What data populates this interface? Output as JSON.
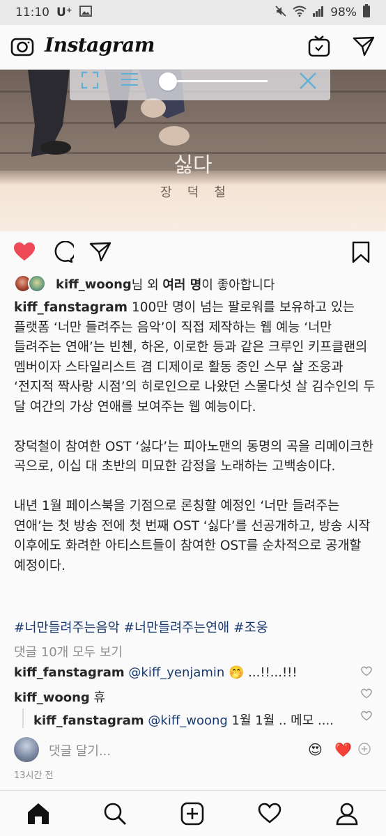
{
  "status_bar": {
    "time": "11:10",
    "carrier": "U⁺",
    "battery": "98%"
  },
  "header": {
    "logo": "Instagram"
  },
  "media": {
    "title": "싫다",
    "artist": "장덕철"
  },
  "likes": {
    "user": "kiff_woong",
    "middle": "님 외 ",
    "others": "여러 명",
    "suffix": "이 좋아합니다"
  },
  "caption": {
    "user": "kiff_fanstagram",
    "paragraphs": [
      " 100만 명이 넘는 팔로워를 보유하고 있는 플랫폼 ‘너만 들려주는 음악’이 직접 제작하는 웹 예능 ‘너만 들려주는 연애’는 빈첸, 하온, 이로한 등과 같은 크루인 키프클랜의 멤버이자 스타일리스트 겸 디제이로 활동 중인 스무 살 조웅과 ‘전지적 짝사랑 시점’의 히로인으로 나왔던 스물다섯 살 김수인의 두 달 여간의 가상 연애를 보여주는 웹 예능이다.",
      "장덕철이 참여한 OST ‘싫다’는 피아노맨의 동명의 곡을 리메이크한 곡으로, 이십 대 초반의 미묘한 감정을 노래하는 고백송이다.",
      "내년 1월 페이스북을 기점으로 론칭할 예정인 ‘너만 들려주는 연애’는 첫 방송 전에 첫 번째 OST ‘싫다’를 선공개하고, 방송 시작 이후에도 화려한 아티스트들이 참여한 OST를 순차적으로 공개할 예정이다."
    ],
    "hashtags": "#너만들려주는음악 #너만들려주는연애 #조웅"
  },
  "comments": {
    "view_all": "댓글 10개 모두 보기",
    "items": [
      {
        "user": "kiff_fanstagram",
        "mention": "@kiff_yenjamin",
        "text": " 🤭 ...!!...!!!"
      },
      {
        "user": "kiff_woong",
        "mention": "",
        "text": " 휴"
      },
      {
        "user": "kiff_fanstagram",
        "mention": "@kiff_woong",
        "text": " 1월 1월 .. 메모 ...."
      }
    ],
    "placeholder": "댓글 달기...",
    "quick_emojis": [
      "😍",
      "❤️"
    ],
    "timestamp": "13시간 전"
  },
  "colors": {
    "like_red": "#ed4956",
    "hashtag_blue": "#1a3a6e",
    "muted_gray": "#8e8e8e"
  }
}
